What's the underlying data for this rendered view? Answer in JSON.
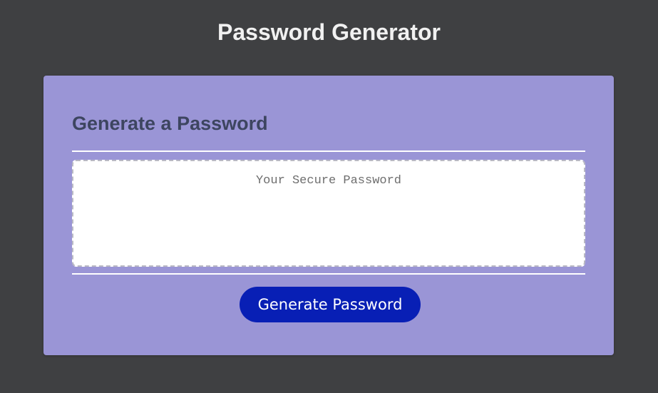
{
  "header": {
    "title": "Password Generator"
  },
  "card": {
    "title": "Generate a Password",
    "password": {
      "value": "",
      "placeholder": "Your Secure Password"
    },
    "generate_button_label": "Generate Password"
  },
  "colors": {
    "page_background": "#3f4042",
    "card_background": "#9a95d6",
    "button_background": "#081fb5",
    "card_title_text": "#3d4560"
  }
}
